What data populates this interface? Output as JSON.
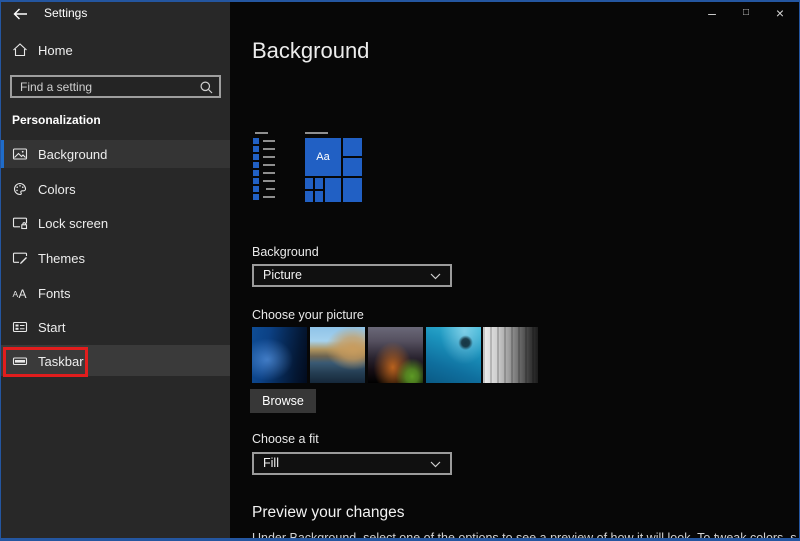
{
  "window": {
    "title": "Settings",
    "controls": [
      {
        "name": "minimize",
        "glyph": "–"
      },
      {
        "name": "maximize",
        "glyph": "□"
      },
      {
        "name": "close",
        "glyph": "×"
      }
    ]
  },
  "colors": {
    "window_border": "#2456a0",
    "sidebar_bg": "#282828",
    "main_bg": "#070707",
    "selected_accent": "#1f6cc9",
    "tile_blue": "#2160c4",
    "annotation_red": "#e11d1d"
  },
  "sidebar": {
    "home_label": "Home",
    "search_placeholder": "Find a setting",
    "section_header": "Personalization",
    "items": [
      {
        "label": "Background",
        "selected": true
      },
      {
        "label": "Colors"
      },
      {
        "label": "Lock screen"
      },
      {
        "label": "Themes"
      },
      {
        "label": "Fonts"
      },
      {
        "label": "Start"
      },
      {
        "label": "Taskbar",
        "highlighted": true,
        "annotated": true
      }
    ]
  },
  "main": {
    "page_title": "Background",
    "preview": {
      "sample_text": "Aa"
    },
    "background_section": {
      "label": "Background",
      "dropdown_value": "Picture"
    },
    "picture_section": {
      "label": "Choose your picture",
      "thumbnails": [
        {
          "name": "windows-default-hero"
        },
        {
          "name": "beach-rocks"
        },
        {
          "name": "night-sky-camp"
        },
        {
          "name": "underwater-turtle"
        },
        {
          "name": "granite-cliff"
        }
      ],
      "browse_label": "Browse"
    },
    "fit_section": {
      "label": "Choose a fit",
      "dropdown_value": "Fill"
    },
    "preview_section": {
      "heading": "Preview your changes",
      "body": "Under Background, select one of the options to see a preview of how it will look. To tweak colors, sounds, and"
    }
  }
}
